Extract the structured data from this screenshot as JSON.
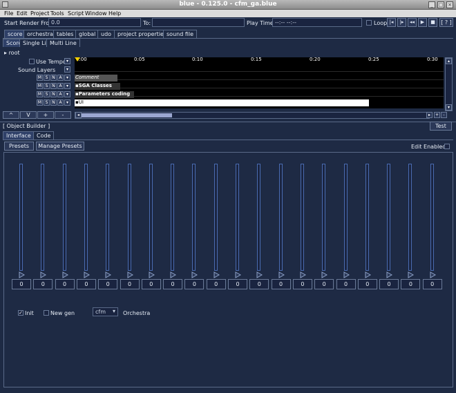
{
  "window": {
    "title": "blue - 0.125.0 - cfm_ga.blue",
    "help_label": "?"
  },
  "menu": [
    "File",
    "Edit",
    "Project",
    "Tools",
    "Script",
    "Window",
    "Help"
  ],
  "render": {
    "start_label": "Start Render From:",
    "start_value": "0.0",
    "to_label": "To:",
    "to_value": "",
    "play_time_label": "Play Time:",
    "play_time_value": "--:-- --:--",
    "loop_label": "Loop",
    "help_label": "[ ? ]"
  },
  "main_tabs": [
    "score",
    "orchestra",
    "tables",
    "global",
    "udo",
    "project properties",
    "sound file"
  ],
  "score_tabs": [
    "Score",
    "Single Line",
    "Multi Line"
  ],
  "score": {
    "root_label": "root",
    "use_tempo_label": "Use Tempo",
    "sound_layers_label": "Sound Layers",
    "layer_buttons": [
      "M",
      "S",
      "N",
      "A"
    ],
    "layer_nav": [
      "^",
      "V",
      "+",
      "-"
    ],
    "ruler": [
      "0:00",
      "0:05",
      "0:10",
      "0:15",
      "0:20",
      "0:25",
      "0:30"
    ],
    "blocks": [
      "Comment",
      "SGA Classes",
      "Parameters coding",
      "UI"
    ]
  },
  "object_builder": {
    "title": "[ Object Builder ]",
    "test_label": "Test",
    "tabs": [
      "Interface",
      "Code"
    ],
    "presets_label": "Presets",
    "manage_presets_label": "Manage Presets",
    "edit_enabled_label": "Edit Enabled:",
    "slider_values": [
      "0",
      "0",
      "0",
      "0",
      "0",
      "0",
      "0",
      "0",
      "0",
      "0",
      "0",
      "0",
      "0",
      "0",
      "0",
      "0",
      "0",
      "0",
      "0",
      "0"
    ],
    "init_label": "Init",
    "new_gen_label": "New gen",
    "dropdown_value": "cfm",
    "orchestra_label": "Orchestra"
  },
  "colors": {
    "panel": "#1e2a44",
    "slider_accent": "#4a6cb2",
    "score_block_white": "#ffffff"
  }
}
